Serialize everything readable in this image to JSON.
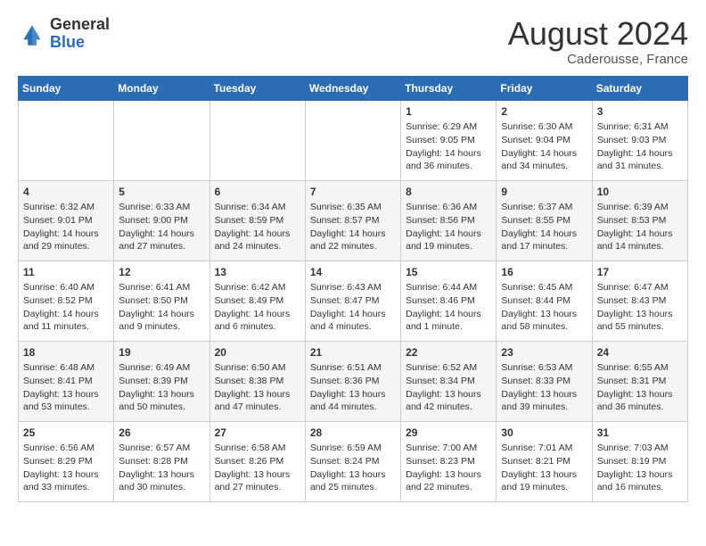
{
  "logo": {
    "general": "General",
    "blue": "Blue"
  },
  "title": "August 2024",
  "subtitle": "Caderousse, France",
  "days_of_week": [
    "Sunday",
    "Monday",
    "Tuesday",
    "Wednesday",
    "Thursday",
    "Friday",
    "Saturday"
  ],
  "weeks": [
    [
      {
        "day": "",
        "content": ""
      },
      {
        "day": "",
        "content": ""
      },
      {
        "day": "",
        "content": ""
      },
      {
        "day": "",
        "content": ""
      },
      {
        "day": "1",
        "content": "Sunrise: 6:29 AM\nSunset: 9:05 PM\nDaylight: 14 hours and 36 minutes."
      },
      {
        "day": "2",
        "content": "Sunrise: 6:30 AM\nSunset: 9:04 PM\nDaylight: 14 hours and 34 minutes."
      },
      {
        "day": "3",
        "content": "Sunrise: 6:31 AM\nSunset: 9:03 PM\nDaylight: 14 hours and 31 minutes."
      }
    ],
    [
      {
        "day": "4",
        "content": "Sunrise: 6:32 AM\nSunset: 9:01 PM\nDaylight: 14 hours and 29 minutes."
      },
      {
        "day": "5",
        "content": "Sunrise: 6:33 AM\nSunset: 9:00 PM\nDaylight: 14 hours and 27 minutes."
      },
      {
        "day": "6",
        "content": "Sunrise: 6:34 AM\nSunset: 8:59 PM\nDaylight: 14 hours and 24 minutes."
      },
      {
        "day": "7",
        "content": "Sunrise: 6:35 AM\nSunset: 8:57 PM\nDaylight: 14 hours and 22 minutes."
      },
      {
        "day": "8",
        "content": "Sunrise: 6:36 AM\nSunset: 8:56 PM\nDaylight: 14 hours and 19 minutes."
      },
      {
        "day": "9",
        "content": "Sunrise: 6:37 AM\nSunset: 8:55 PM\nDaylight: 14 hours and 17 minutes."
      },
      {
        "day": "10",
        "content": "Sunrise: 6:39 AM\nSunset: 8:53 PM\nDaylight: 14 hours and 14 minutes."
      }
    ],
    [
      {
        "day": "11",
        "content": "Sunrise: 6:40 AM\nSunset: 8:52 PM\nDaylight: 14 hours and 11 minutes."
      },
      {
        "day": "12",
        "content": "Sunrise: 6:41 AM\nSunset: 8:50 PM\nDaylight: 14 hours and 9 minutes."
      },
      {
        "day": "13",
        "content": "Sunrise: 6:42 AM\nSunset: 8:49 PM\nDaylight: 14 hours and 6 minutes."
      },
      {
        "day": "14",
        "content": "Sunrise: 6:43 AM\nSunset: 8:47 PM\nDaylight: 14 hours and 4 minutes."
      },
      {
        "day": "15",
        "content": "Sunrise: 6:44 AM\nSunset: 8:46 PM\nDaylight: 14 hours and 1 minute."
      },
      {
        "day": "16",
        "content": "Sunrise: 6:45 AM\nSunset: 8:44 PM\nDaylight: 13 hours and 58 minutes."
      },
      {
        "day": "17",
        "content": "Sunrise: 6:47 AM\nSunset: 8:43 PM\nDaylight: 13 hours and 55 minutes."
      }
    ],
    [
      {
        "day": "18",
        "content": "Sunrise: 6:48 AM\nSunset: 8:41 PM\nDaylight: 13 hours and 53 minutes."
      },
      {
        "day": "19",
        "content": "Sunrise: 6:49 AM\nSunset: 8:39 PM\nDaylight: 13 hours and 50 minutes."
      },
      {
        "day": "20",
        "content": "Sunrise: 6:50 AM\nSunset: 8:38 PM\nDaylight: 13 hours and 47 minutes."
      },
      {
        "day": "21",
        "content": "Sunrise: 6:51 AM\nSunset: 8:36 PM\nDaylight: 13 hours and 44 minutes."
      },
      {
        "day": "22",
        "content": "Sunrise: 6:52 AM\nSunset: 8:34 PM\nDaylight: 13 hours and 42 minutes."
      },
      {
        "day": "23",
        "content": "Sunrise: 6:53 AM\nSunset: 8:33 PM\nDaylight: 13 hours and 39 minutes."
      },
      {
        "day": "24",
        "content": "Sunrise: 6:55 AM\nSunset: 8:31 PM\nDaylight: 13 hours and 36 minutes."
      }
    ],
    [
      {
        "day": "25",
        "content": "Sunrise: 6:56 AM\nSunset: 8:29 PM\nDaylight: 13 hours and 33 minutes."
      },
      {
        "day": "26",
        "content": "Sunrise: 6:57 AM\nSunset: 8:28 PM\nDaylight: 13 hours and 30 minutes."
      },
      {
        "day": "27",
        "content": "Sunrise: 6:58 AM\nSunset: 8:26 PM\nDaylight: 13 hours and 27 minutes."
      },
      {
        "day": "28",
        "content": "Sunrise: 6:59 AM\nSunset: 8:24 PM\nDaylight: 13 hours and 25 minutes."
      },
      {
        "day": "29",
        "content": "Sunrise: 7:00 AM\nSunset: 8:23 PM\nDaylight: 13 hours and 22 minutes."
      },
      {
        "day": "30",
        "content": "Sunrise: 7:01 AM\nSunset: 8:21 PM\nDaylight: 13 hours and 19 minutes."
      },
      {
        "day": "31",
        "content": "Sunrise: 7:03 AM\nSunset: 8:19 PM\nDaylight: 13 hours and 16 minutes."
      }
    ]
  ]
}
